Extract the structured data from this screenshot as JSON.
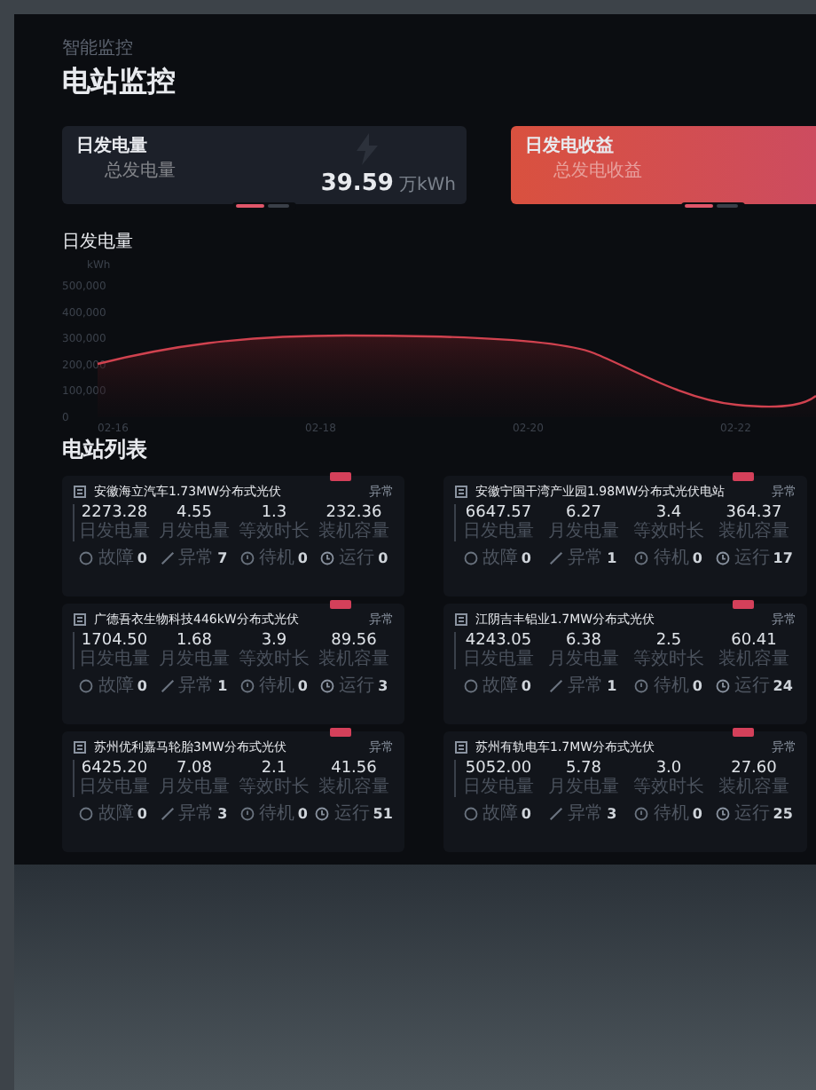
{
  "breadcrumb": "智能监控",
  "title": "电站监控",
  "stat_cards": [
    {
      "kind": "dark",
      "label": "日发电量",
      "sublabel": "总发电量",
      "value": "39.59",
      "unit": "万kWh"
    },
    {
      "kind": "highlight",
      "label": "日发电收益",
      "sublabel": "总发电收益"
    }
  ],
  "chart": {
    "title": "日发电量",
    "y_axis_labels": [
      "kWh",
      "500,000",
      "400,000",
      "300,000",
      "200,000",
      "100,000",
      "0"
    ],
    "x_axis_labels": [
      "02-16",
      "02-18",
      "02-20",
      "02-22"
    ]
  },
  "station_list": {
    "title": "电站列表",
    "stations": [
      {
        "name": "安徽海立汽车1.73MW分布式光伏",
        "action": "异常",
        "metrics": [
          {
            "value": "2273.28",
            "label": "日发电量"
          },
          {
            "value": "4.55",
            "label": "月发电量"
          },
          {
            "value": "1.3",
            "label": "等效时长"
          },
          {
            "value": "232.36",
            "label": "装机容量"
          }
        ],
        "statuses": [
          {
            "kind": "fault",
            "label": "故障",
            "count": "0"
          },
          {
            "kind": "abnormal",
            "label": "异常",
            "count": "7"
          },
          {
            "kind": "standby",
            "label": "待机",
            "count": "0"
          },
          {
            "kind": "running",
            "label": "运行",
            "count": "0"
          }
        ]
      },
      {
        "name": "安徽宁国干湾产业园1.98MW分布式光伏电站",
        "action": "异常",
        "metrics": [
          {
            "value": "6647.57",
            "label": "日发电量"
          },
          {
            "value": "6.27",
            "label": "月发电量"
          },
          {
            "value": "3.4",
            "label": "等效时长"
          },
          {
            "value": "364.37",
            "label": "装机容量"
          }
        ],
        "statuses": [
          {
            "kind": "fault",
            "label": "故障",
            "count": "0"
          },
          {
            "kind": "abnormal",
            "label": "异常",
            "count": "1"
          },
          {
            "kind": "standby",
            "label": "待机",
            "count": "0"
          },
          {
            "kind": "running",
            "label": "运行",
            "count": "17"
          }
        ]
      },
      {
        "name": "广德吾衣生物科技446kW分布式光伏",
        "action": "异常",
        "metrics": [
          {
            "value": "1704.50",
            "label": "日发电量"
          },
          {
            "value": "1.68",
            "label": "月发电量"
          },
          {
            "value": "3.9",
            "label": "等效时长"
          },
          {
            "value": "89.56",
            "label": "装机容量"
          }
        ],
        "statuses": [
          {
            "kind": "fault",
            "label": "故障",
            "count": "0"
          },
          {
            "kind": "abnormal",
            "label": "异常",
            "count": "1"
          },
          {
            "kind": "standby",
            "label": "待机",
            "count": "0"
          },
          {
            "kind": "running",
            "label": "运行",
            "count": "3"
          }
        ]
      },
      {
        "name": "江阴吉丰铝业1.7MW分布式光伏",
        "action": "异常",
        "metrics": [
          {
            "value": "4243.05",
            "label": "日发电量"
          },
          {
            "value": "6.38",
            "label": "月发电量"
          },
          {
            "value": "2.5",
            "label": "等效时长"
          },
          {
            "value": "60.41",
            "label": "装机容量"
          }
        ],
        "statuses": [
          {
            "kind": "fault",
            "label": "故障",
            "count": "0"
          },
          {
            "kind": "abnormal",
            "label": "异常",
            "count": "1"
          },
          {
            "kind": "standby",
            "label": "待机",
            "count": "0"
          },
          {
            "kind": "running",
            "label": "运行",
            "count": "24"
          }
        ]
      },
      {
        "name": "苏州优利嘉马轮胎3MW分布式光伏",
        "action": "异常",
        "metrics": [
          {
            "value": "6425.20",
            "label": "日发电量"
          },
          {
            "value": "7.08",
            "label": "月发电量"
          },
          {
            "value": "2.1",
            "label": "等效时长"
          },
          {
            "value": "41.56",
            "label": "装机容量"
          }
        ],
        "statuses": [
          {
            "kind": "fault",
            "label": "故障",
            "count": "0"
          },
          {
            "kind": "abnormal",
            "label": "异常",
            "count": "3"
          },
          {
            "kind": "standby",
            "label": "待机",
            "count": "0"
          },
          {
            "kind": "running",
            "label": "运行",
            "count": "51"
          }
        ]
      },
      {
        "name": "苏州有轨电车1.7MW分布式光伏",
        "action": "异常",
        "metrics": [
          {
            "value": "5052.00",
            "label": "日发电量"
          },
          {
            "value": "5.78",
            "label": "月发电量"
          },
          {
            "value": "3.0",
            "label": "等效时长"
          },
          {
            "value": "27.60",
            "label": "装机容量"
          }
        ],
        "statuses": [
          {
            "kind": "fault",
            "label": "故障",
            "count": "0"
          },
          {
            "kind": "abnormal",
            "label": "异常",
            "count": "3"
          },
          {
            "kind": "standby",
            "label": "待机",
            "count": "0"
          },
          {
            "kind": "running",
            "label": "运行",
            "count": "25"
          }
        ]
      }
    ]
  }
}
